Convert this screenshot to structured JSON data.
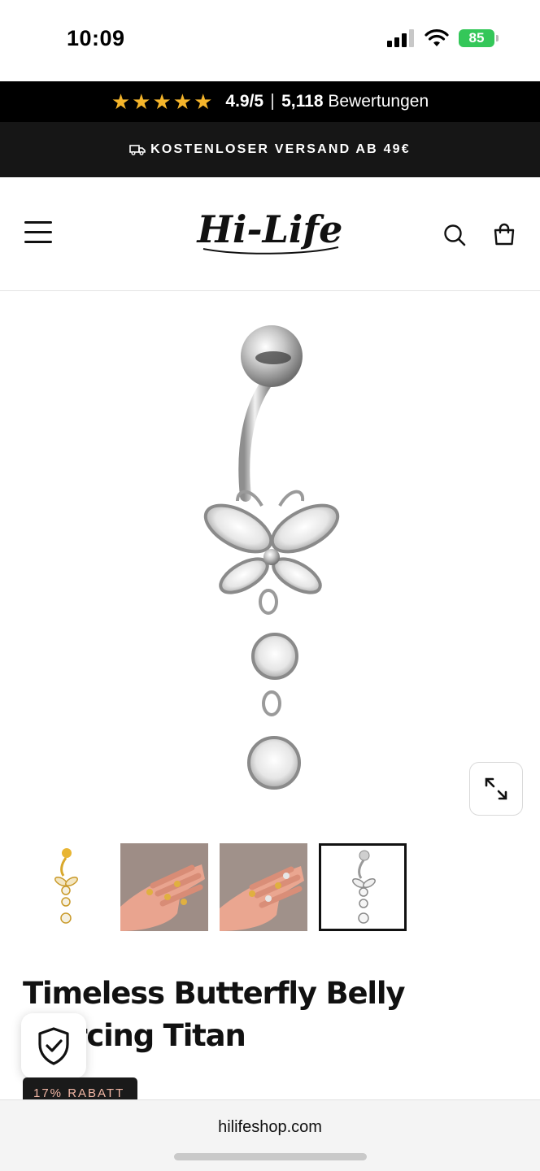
{
  "status_bar": {
    "time": "10:09",
    "battery": "85"
  },
  "rating_bar": {
    "stars": 5,
    "rating": "4.9/5",
    "review_count": "5,118",
    "review_label": "Bewertungen",
    "star_color": "#f5b52b"
  },
  "shipping_bar": {
    "text": "KOSTENLOSER VERSAND AB 49€"
  },
  "header": {
    "logo_text": "Hi-Life"
  },
  "product": {
    "title": "Timeless Butterfly Belly Piercing Titan",
    "discount": "17% RABATT",
    "thumbnails": [
      "gold-piercing",
      "hand-photo-1",
      "hand-photo-2",
      "silver-piercing"
    ],
    "selected_thumbnail": 3
  },
  "browser": {
    "url": "hilifeshop.com"
  },
  "colors": {
    "black": "#000000",
    "accent_badge_text": "#f2b7a5",
    "battery_green": "#34c759"
  }
}
